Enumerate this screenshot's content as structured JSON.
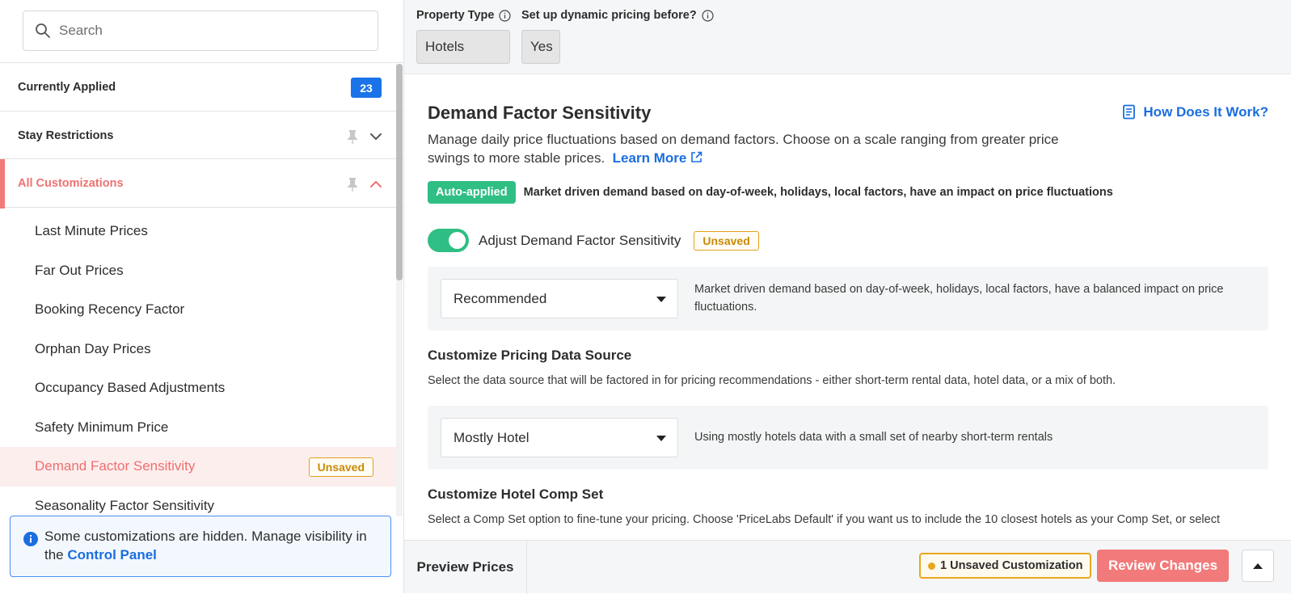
{
  "sidebar": {
    "search_placeholder": "Search",
    "sections": [
      {
        "label": "Currently Applied",
        "count": "23"
      },
      {
        "label": "Stay Restrictions"
      },
      {
        "label": "All Customizations"
      }
    ],
    "items": [
      {
        "label": "Last Minute Prices"
      },
      {
        "label": "Far Out Prices"
      },
      {
        "label": "Booking Recency Factor"
      },
      {
        "label": "Orphan Day Prices"
      },
      {
        "label": "Occupancy Based Adjustments"
      },
      {
        "label": "Safety Minimum Price"
      },
      {
        "label": "Demand Factor Sensitivity",
        "badge": "Unsaved"
      },
      {
        "label": "Seasonality Factor Sensitivity"
      }
    ],
    "info": {
      "text": "Some customizations are hidden. Manage visibility in the",
      "link": "Control Panel"
    }
  },
  "topbar": {
    "property_type_label": "Property Type",
    "property_type_value": "Hotels",
    "dynamic_label": "Set up dynamic pricing before?",
    "dynamic_value": "Yes"
  },
  "main": {
    "title": "Demand Factor Sensitivity",
    "how_link": "How Does It Work?",
    "description": "Manage daily price fluctuations based on demand factors. Choose on a scale ranging from greater price swings to more stable prices.",
    "learn_more": "Learn More",
    "auto_badge": "Auto-applied",
    "auto_text": "Market driven demand based on day-of-week, holidays, local factors, have an impact on price fluctuations",
    "toggle_label": "Adjust Demand Factor Sensitivity",
    "toggle_on": true,
    "toggle_badge": "Unsaved",
    "demand_select": "Recommended",
    "demand_select_desc": "Market driven demand based on day-of-week, holidays, local factors, have a balanced impact on price fluctuations.",
    "data_source_title": "Customize Pricing Data Source",
    "data_source_desc": "Select the data source that will be factored in for pricing recommendations - either short-term rental data, hotel data, or a mix of both.",
    "data_source_select": "Mostly Hotel",
    "data_source_select_desc": "Using mostly hotels data with a small set of nearby short-term rentals",
    "comp_set_title": "Customize Hotel Comp Set",
    "comp_set_desc": "Select a Comp Set option to fine-tune your pricing. Choose 'PriceLabs Default' if you want us to include the 10 closest hotels as your Comp Set, or select"
  },
  "footer": {
    "preview": "Preview Prices",
    "unsaved_count": "1 Unsaved Customization",
    "review": "Review Changes"
  },
  "colors": {
    "accent_blue": "#1a73e8",
    "accent_red": "#f27a7a",
    "green": "#2fbe84",
    "warning": "#e9a71d"
  }
}
